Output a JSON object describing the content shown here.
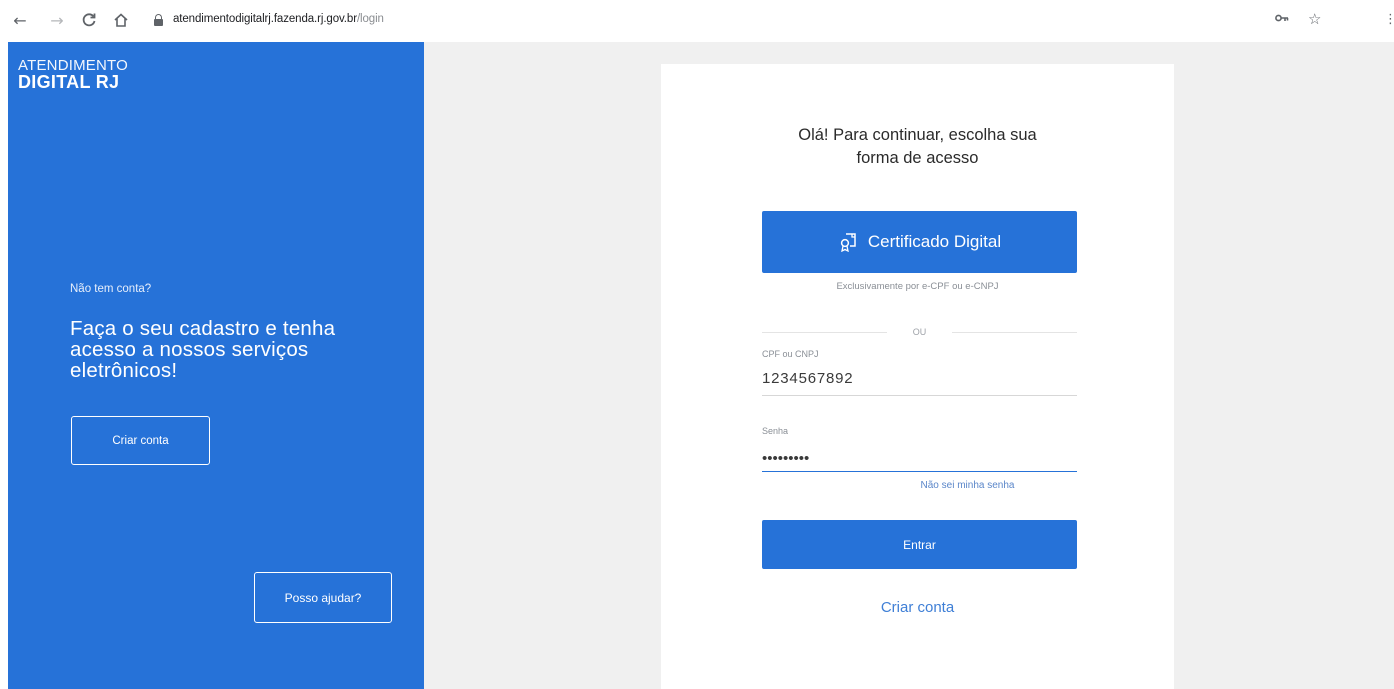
{
  "browser": {
    "back_glyph": "←",
    "forward_glyph": "→",
    "reload_glyph": "C",
    "home_glyph": "⌂",
    "url_host": "atendimentodigitalrj.fazenda.rj.gov.br",
    "url_path": "/login",
    "key_glyph": "⊶",
    "star_glyph": "☆",
    "menu_glyph": "⋮"
  },
  "left_panel": {
    "logo_top": "ATENDIMENTO",
    "logo_bottom": "DIGITAL RJ",
    "no_account": "Não tem conta?",
    "headline": "Faça o seu cadastro e tenha acesso a nossos serviços eletrônicos!",
    "create_account_button": "Criar conta",
    "help_button": "Posso ajudar?",
    "background_color": "#2672d8"
  },
  "login_card": {
    "title_line1": "Olá! Para continuar, escolha sua",
    "title_line2": "forma de acesso",
    "certificate_button": "Certificado Digital",
    "certificate_note": "Exclusivamente por e-CPF ou e-CNPJ",
    "divider_text": "OU",
    "cpf_label": "CPF ou CNPJ",
    "cpf_value": "1234567892",
    "password_label": "Senha",
    "password_value": "•••••••••",
    "forgot_password": "Não sei minha senha",
    "enter_button": "Entrar",
    "create_account_link": "Criar conta",
    "accent_color": "#2672d8"
  }
}
